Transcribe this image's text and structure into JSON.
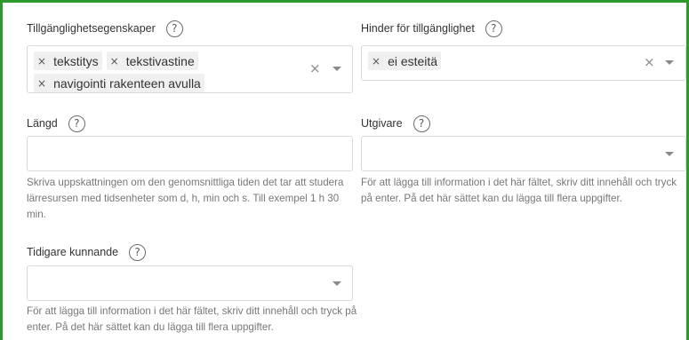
{
  "accessibility_features": {
    "label": "Tillgänglighetsegenskaper",
    "help": "?",
    "chips": [
      {
        "remove": "×",
        "text": "tekstitys"
      },
      {
        "remove": "×",
        "text": "tekstivastine"
      },
      {
        "remove": "×",
        "text": "navigointi rakenteen avulla"
      }
    ],
    "clear": "×"
  },
  "accessibility_hazards": {
    "label": "Hinder för tillgänglighet",
    "help": "?",
    "chips": [
      {
        "remove": "×",
        "text": "ei esteitä"
      }
    ],
    "clear": "×"
  },
  "duration": {
    "label": "Längd",
    "help": "?",
    "value": "",
    "hint": "Skriva uppskattningen om den genomsnittliga tiden det tar att studera lärresursen med tidsenheter som d, h, min och s. Till exempel 1 h 30 min."
  },
  "publisher": {
    "label": "Utgivare",
    "help": "?",
    "value": "",
    "hint": "För att lägga till information i det här fältet, skriv ditt innehåll och tryck på enter. På det här sättet kan du lägga till flera uppgifter."
  },
  "prior_knowledge": {
    "label": "Tidigare kunnande",
    "help": "?",
    "value": "",
    "hint": "För att lägga till information i det här fältet, skriv ditt innehåll och tryck på enter. På det här sättet kan du lägga till flera uppgifter."
  },
  "colors": {
    "frame_border": "#2e9a2e",
    "input_border": "#d9d9d9",
    "chip_bg": "#f0f0f0",
    "hint_text": "#777777"
  }
}
